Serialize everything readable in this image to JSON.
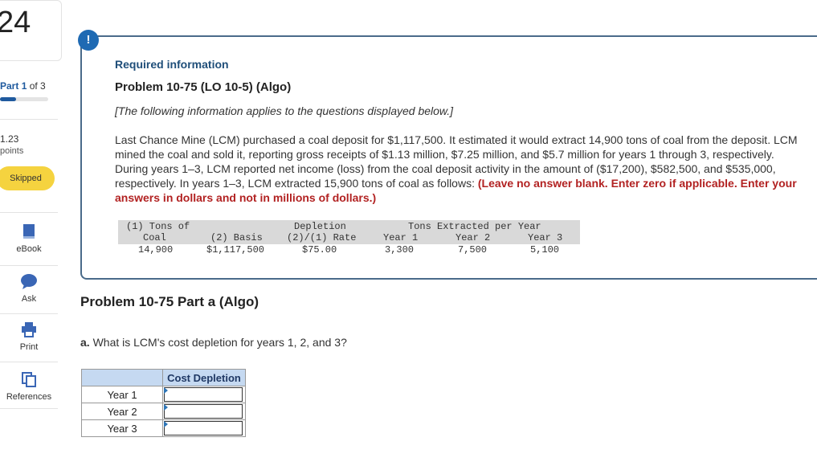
{
  "sidebar": {
    "question_number": "24",
    "part": {
      "label": "Part",
      "current": "1",
      "of_total": "of 3",
      "progress_fraction": 0.33
    },
    "points": {
      "value": "1.23",
      "label": "points"
    },
    "status_button": "Skipped",
    "tools": [
      {
        "label": "eBook",
        "icon": "book-icon"
      },
      {
        "label": "Ask",
        "icon": "chat-bubble-icon"
      },
      {
        "label": "Print",
        "icon": "printer-icon"
      },
      {
        "label": "References",
        "icon": "copy-icon"
      }
    ]
  },
  "callout": {
    "alert_symbol": "!",
    "required_heading": "Required information",
    "problem_title": "Problem 10-75 (LO 10-5) (Algo)",
    "bracket_note": "[The following information applies to the questions displayed below.]",
    "body_text": "Last Chance Mine (LCM) purchased a coal deposit for $1,117,500. It estimated it would extract 14,900 tons of coal from the deposit. LCM mined the coal and sold it, reporting gross receipts of $1.13 million, $7.25 million, and $5.7 million for years 1 through 3, respectively. During years 1–3, LCM reported net income (loss) from the coal deposit activity in the amount of ($17,200), $582,500, and $535,000, respectively. In years 1–3, LCM extracted 15,900 tons of coal as follows: ",
    "instruction_text": "(Leave no answer blank. Enter zero if applicable. Enter your answers in dollars and not in millions of dollars.)",
    "data_table": {
      "col1_line1": "(1) Tons of",
      "col1_line2": "Coal",
      "col1_value": "14,900",
      "col2_header": "(2) Basis",
      "col2_value": "$1,117,500",
      "col3_line1": "Depletion",
      "col3_line2": "(2)/(1) Rate",
      "col3_value": "$75.00",
      "group_header": "Tons Extracted per Year",
      "year1_header": "Year 1",
      "year1_value": "3,300",
      "year2_header": "Year 2",
      "year2_value": "7,500",
      "year3_header": "Year 3",
      "year3_value": "5,100"
    }
  },
  "part_a": {
    "title": "Problem 10-75 Part a (Algo)",
    "question_letter": "a.",
    "question_text": "What is LCM's cost depletion for years 1, 2, and 3?",
    "answer_table": {
      "header": "Cost Depletion",
      "rows": [
        {
          "label": "Year 1",
          "value": ""
        },
        {
          "label": "Year 2",
          "value": ""
        },
        {
          "label": "Year 3",
          "value": ""
        }
      ]
    }
  }
}
